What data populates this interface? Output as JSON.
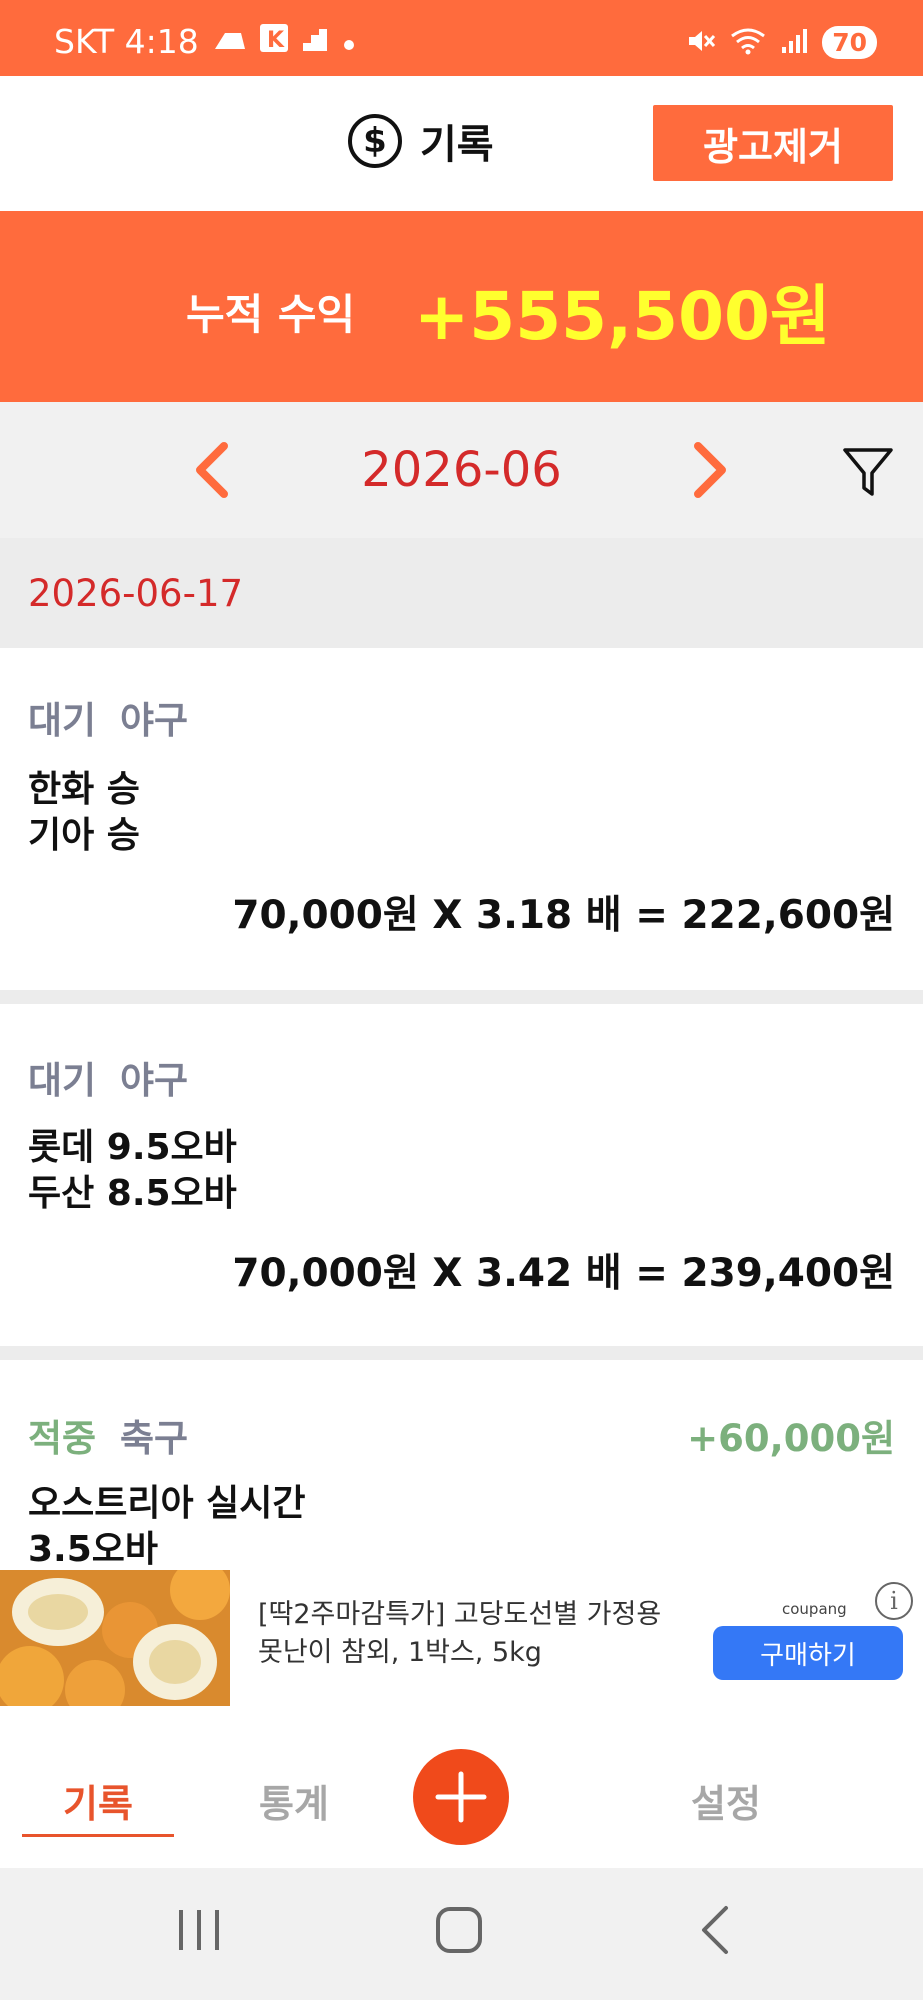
{
  "status_bar": {
    "carrier_time": "SKT 4:18",
    "battery": "70",
    "icons": [
      "cloud-icon",
      "k-icon",
      "chart-icon",
      "dot-icon",
      "mute-icon",
      "wifi-icon",
      "signal-icon",
      "battery-icon"
    ]
  },
  "header": {
    "icon": "dollar-icon",
    "title": "기록",
    "ad_remove_label": "광고제거"
  },
  "profit_banner": {
    "label": "누적 수익",
    "value": "+555,500원"
  },
  "month_nav": {
    "month": "2026-06",
    "prev_icon": "chevron-left-icon",
    "next_icon": "chevron-right-icon",
    "filter_icon": "filter-icon"
  },
  "date_group": {
    "date": "2026-06-17"
  },
  "records": [
    {
      "status": "대기",
      "sport": "야구",
      "pick_line1": "한화 승",
      "pick_line2": "기아 승",
      "calc": "70,000원 X 3.18 배 = 222,600원",
      "profit": ""
    },
    {
      "status": "대기",
      "sport": "야구",
      "pick_line1": "롯데 9.5오바",
      "pick_line2": "두산 8.5오바",
      "calc": "70,000원 X 3.42 배 = 239,400원",
      "profit": ""
    },
    {
      "status": "적중",
      "sport": "축구",
      "pick_line1": "오스트리아 실시간",
      "pick_line2": "3.5오바",
      "calc": "",
      "profit": "+60,000원"
    }
  ],
  "ad": {
    "text_line1": "[딱2주마감특가] 고당도선별 가정용",
    "text_line2": "못난이 참외, 1박스, 5kg",
    "brand": "coupang",
    "info_label": "i",
    "buy_label": "구매하기"
  },
  "bottom_nav": {
    "tab_records": "기록",
    "tab_stats": "통계",
    "tab_settings": "설정",
    "add_icon": "plus-icon"
  },
  "colors": {
    "accent": "#ff6b3d",
    "profit_text": "#ffff2e",
    "month_red": "#d42a2a",
    "status_gray": "#7b7f92",
    "hit_green": "#7cb07d",
    "ad_button": "#3478f6"
  }
}
